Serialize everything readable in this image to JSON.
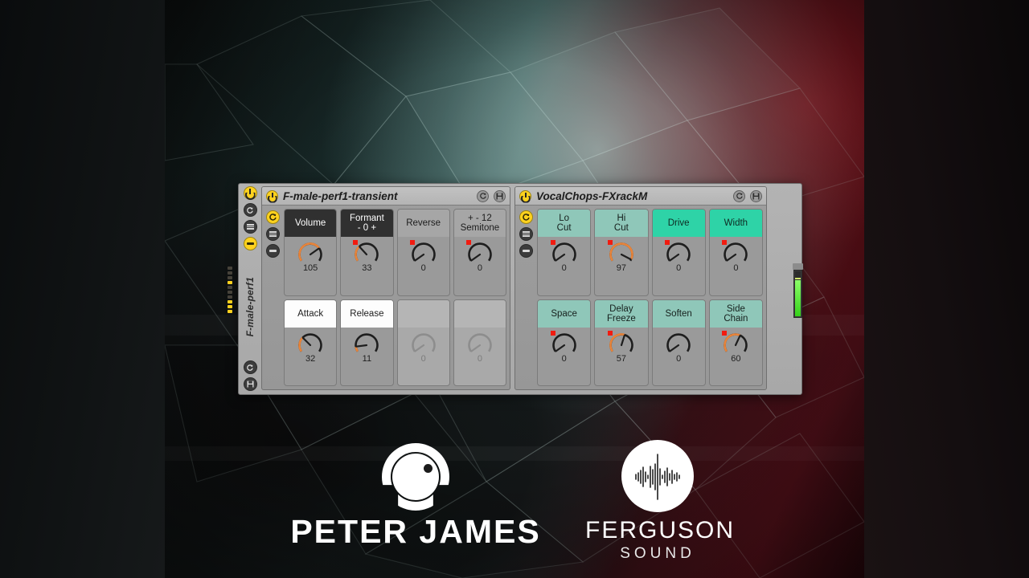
{
  "background": {
    "description": "low-poly geometric artwork video still",
    "left_tone": "#101314",
    "right_tone": "#5d121c",
    "teal_tone": "#3d6b66"
  },
  "branding": {
    "peter_james": {
      "name": "PETER JAMES",
      "mark": "knob-logo-icon"
    },
    "ferguson_sound": {
      "name": "FERGUSON",
      "sub": "SOUND",
      "mark": "waveform-logo-icon"
    }
  },
  "track": {
    "name": "F-male-perf1",
    "buttons": [
      {
        "name": "activator",
        "icon": "power-icon",
        "state": "on"
      },
      {
        "name": "hot-swap",
        "icon": "hotswap-icon",
        "state": "off"
      },
      {
        "name": "chain-list",
        "icon": "list-icon",
        "state": "off"
      },
      {
        "name": "unfold",
        "icon": "minus-icon",
        "state": "on"
      },
      {
        "name": "track-hotswap",
        "icon": "hotswap-icon",
        "state": "off"
      },
      {
        "name": "track-save",
        "icon": "save-icon",
        "state": "off"
      }
    ]
  },
  "devices": [
    {
      "title": "F-male-perf1-transient",
      "activator": "on",
      "title_buttons": [
        {
          "name": "hot-swap",
          "icon": "hotswap-icon"
        },
        {
          "name": "save-preset",
          "icon": "save-icon"
        }
      ],
      "rail_buttons": [
        {
          "name": "macro-toggle",
          "icon": "macro-icon",
          "state": "on"
        },
        {
          "name": "chain-list",
          "icon": "list-icon",
          "state": "off"
        },
        {
          "name": "unfold",
          "icon": "minus-icon",
          "state": "off"
        }
      ],
      "macros": [
        {
          "label": "Volume",
          "value": "105",
          "style": "dark",
          "dot": false,
          "fill": 0.72,
          "dim": false
        },
        {
          "label": "Formant\n- 0 +",
          "value": "33",
          "style": "dark",
          "dot": true,
          "fill": 0.33,
          "dim": false
        },
        {
          "label": "Reverse",
          "value": "0",
          "style": "gray",
          "dot": true,
          "fill": 0.0,
          "dim": false
        },
        {
          "label": "+ - 12\nSemitone",
          "value": "0",
          "style": "gray",
          "dot": true,
          "fill": 0.0,
          "dim": false
        },
        {
          "label": "Attack",
          "value": "32",
          "style": "white",
          "dot": false,
          "fill": 0.32,
          "dim": false
        },
        {
          "label": "Release",
          "value": "11",
          "style": "white",
          "dot": false,
          "fill": 0.11,
          "dim": false
        },
        {
          "label": "",
          "value": "0",
          "style": "blank",
          "dot": false,
          "fill": 0.0,
          "dim": true
        },
        {
          "label": "",
          "value": "0",
          "style": "blank",
          "dot": false,
          "fill": 0.0,
          "dim": true
        }
      ]
    },
    {
      "title": "VocalChops-FXrackM",
      "activator": "on",
      "title_buttons": [
        {
          "name": "hot-swap",
          "icon": "hotswap-icon"
        },
        {
          "name": "save-preset",
          "icon": "save-icon"
        }
      ],
      "rail_buttons": [
        {
          "name": "macro-toggle",
          "icon": "macro-icon",
          "state": "on"
        },
        {
          "name": "chain-list",
          "icon": "list-icon",
          "state": "off"
        },
        {
          "name": "unfold",
          "icon": "minus-icon",
          "state": "off"
        }
      ],
      "macros": [
        {
          "label": "Lo\nCut",
          "value": "0",
          "style": "teal-l",
          "dot": true,
          "fill": 0.0,
          "dim": false
        },
        {
          "label": "Hi\nCut",
          "value": "97",
          "style": "teal-l",
          "dot": true,
          "fill": 0.97,
          "dim": false
        },
        {
          "label": "Drive",
          "value": "0",
          "style": "teal-d",
          "dot": true,
          "fill": 0.0,
          "dim": false
        },
        {
          "label": "Width",
          "value": "0",
          "style": "teal-d",
          "dot": true,
          "fill": 0.0,
          "dim": false
        },
        {
          "label": "Space",
          "value": "0",
          "style": "teal-l",
          "dot": true,
          "fill": 0.0,
          "dim": false
        },
        {
          "label": "Delay\nFreeze",
          "value": "57",
          "style": "teal-l",
          "dot": true,
          "fill": 0.57,
          "dim": false
        },
        {
          "label": "Soften",
          "value": "0",
          "style": "teal-l",
          "dot": false,
          "fill": 0.0,
          "dim": false
        },
        {
          "label": "Side\nChain",
          "value": "60",
          "style": "teal-l",
          "dot": true,
          "fill": 0.6,
          "dim": false
        }
      ]
    }
  ],
  "meters": {
    "track_dots": [
      false,
      false,
      false,
      true,
      false,
      false,
      false,
      true,
      true,
      true
    ],
    "output_level": "76"
  },
  "colors": {
    "accent_yellow": "#ffd21e",
    "knob_fill": "#e8843a",
    "teal_light": "#8fc7b9",
    "teal_dark": "#2ed3a7",
    "red_dot": "#f11b10",
    "meter_green": "#35d21a"
  }
}
